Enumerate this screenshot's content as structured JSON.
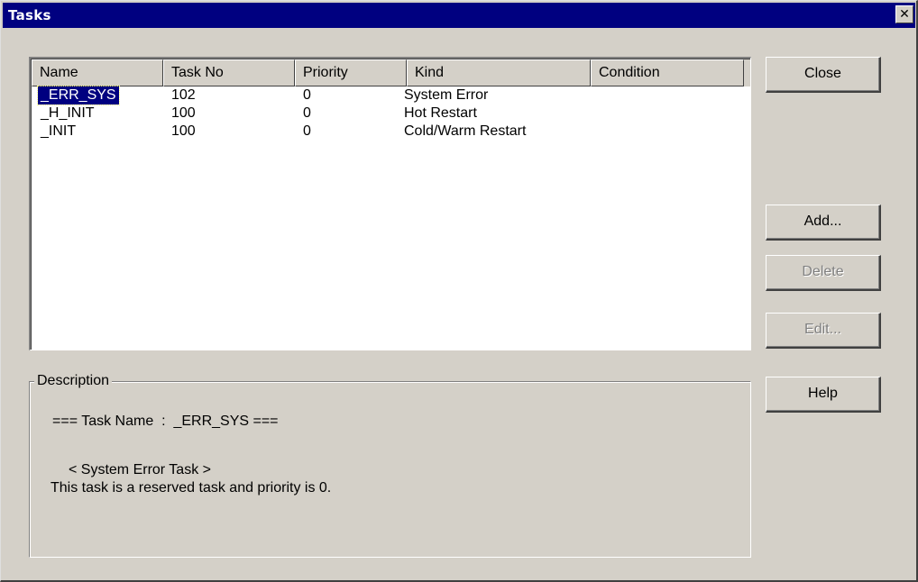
{
  "window": {
    "title": "Tasks",
    "close_glyph": "✕"
  },
  "list": {
    "columns": [
      "Name",
      "Task No",
      "Priority",
      "Kind",
      "Condition"
    ],
    "rows": [
      {
        "name": "_ERR_SYS",
        "task_no": "102",
        "priority": "0",
        "kind": "System Error",
        "condition": "",
        "selected": true
      },
      {
        "name": "_H_INIT",
        "task_no": "100",
        "priority": "0",
        "kind": "Hot Restart",
        "condition": "",
        "selected": false
      },
      {
        "name": "_INIT",
        "task_no": "100",
        "priority": "0",
        "kind": "Cold/Warm Restart",
        "condition": "",
        "selected": false
      }
    ]
  },
  "description": {
    "label": "Description",
    "line1": "=== Task Name  :  _ERR_SYS ===",
    "line2": "< System Error Task >",
    "line3": "This task is a reserved task and priority is 0."
  },
  "buttons": {
    "close": "Close",
    "add": "Add...",
    "delete": "Delete",
    "edit": "Edit...",
    "help": "Help"
  },
  "colors": {
    "selection": "#000080",
    "titlebar": "#000080",
    "face": "#d4d0c8"
  }
}
